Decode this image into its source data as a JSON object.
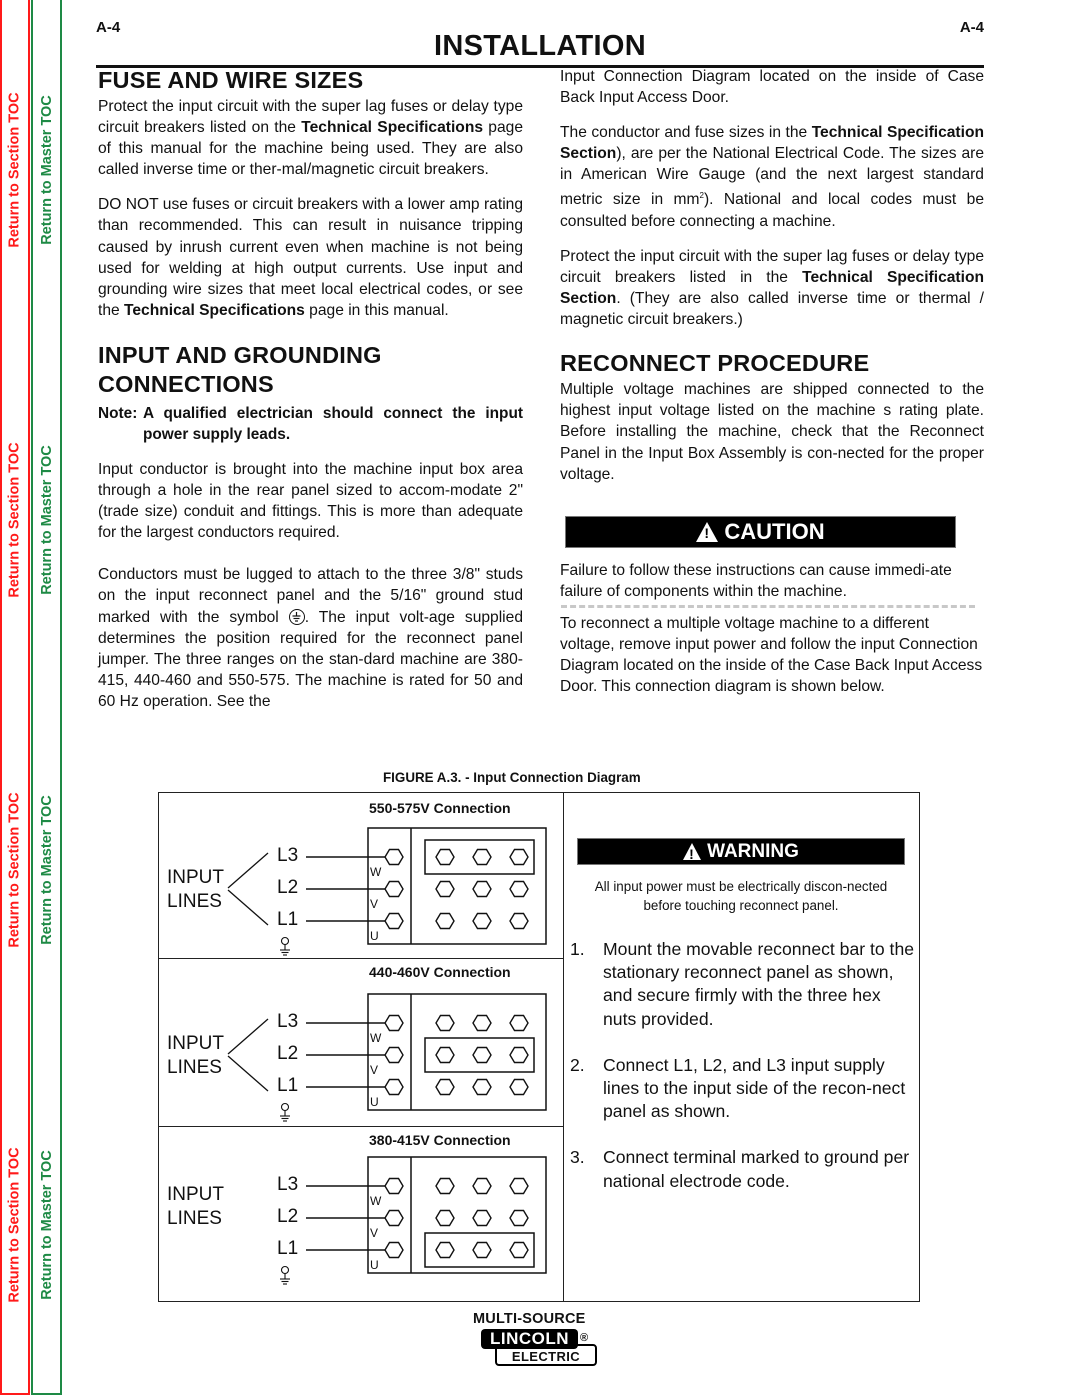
{
  "nav": {
    "section_toc_label": "Return to Section TOC",
    "master_toc_label": "Return to Master TOC",
    "section_color": "#ff1a1a",
    "master_color": "#1e8a45"
  },
  "header": {
    "page_left": "A-4",
    "page_right": "A-4",
    "title": "INSTALLATION"
  },
  "left_column": {
    "fuse_heading": "FUSE AND WIRE SIZES",
    "fuse_p1": {
      "a": "Protect the input circuit with the super lag fuses or delay type circuit breakers listed on the ",
      "b_bold": "Technical Specifications",
      "c": " page of this manual for the machine being used.  They are also called inverse time or ther-mal/magnetic circuit breakers."
    },
    "fuse_p2": {
      "a": "DO NOT use fuses or circuit breakers with a lower amp rating than recommended.  This can result in nuisance tripping caused by inrush current even when machine is not being used for welding at high output currents.  Use input and grounding wire sizes that meet local electrical codes, or see the ",
      "b_bold": "Technical Specifications",
      "c": " page in this manual."
    },
    "input_heading_line1": "INPUT AND GROUNDING",
    "input_heading_line2": "CONNECTIONS",
    "note_label": "Note:",
    "note_text": "A qualified electrician should connect the input power supply leads.",
    "input_p1": "Input conductor is brought into the machine input box area through a hole in the rear panel sized to accom-modate 2\" (trade size) conduit and fittings. This is more than adequate for the largest conductors required.",
    "input_p2": {
      "a": "Conductors must be lugged to attach to the three 3/8\" studs on the input reconnect panel and the 5/16\" ground stud marked with the symbol ",
      "b": ". The input volt-age supplied determines the position required for the reconnect panel jumper. The three ranges on the stan-dard machine are 380-415, 440-460 and 550-575. The machine is rated for 50 and 60 Hz operation. See the"
    }
  },
  "right_column": {
    "cont_p": "Input Connection Diagram located on the inside of Case Back Input Access Door.",
    "cond_p": {
      "a": "The conductor and fuse sizes in the ",
      "b_bold": "Technical Specification Section",
      "c": "), are per the National Electrical Code. The sizes are in American Wire Gauge (and the next largest standard metric size in mm",
      "sup": "2",
      "d": "). National and local codes must be consulted before connecting a machine."
    },
    "protect_p": {
      "a": "Protect the input circuit with the super lag fuses or delay type circuit breakers listed in the ",
      "b_bold": "Technical Specification Section",
      "c": ". (They are also called inverse time or thermal / magnetic circuit breakers.)"
    },
    "reconnect_heading": "RECONNECT PROCEDURE",
    "reconnect_p": "Multiple voltage machines are shipped connected to the highest input voltage listed on the machine s rating plate.  Before installing the machine, check that the Reconnect Panel in the Input Box Assembly is con-nected for the proper voltage.",
    "caution_label": "CAUTION",
    "caution_text": "Failure to follow these instructions can cause immedi-ate failure of components within the machine.",
    "reconnect_p2": "To reconnect a multiple voltage machine to a different voltage, remove input power and follow the input Connection Diagram located on the inside of the Case Back Input Access Door.  This connection diagram is shown below."
  },
  "figure": {
    "caption": "FIGURE A.3. - Input Connection Diagram",
    "input_label_1": "INPUT",
    "input_label_2": "LINES",
    "line_labels": [
      "L3",
      "L2",
      "L1"
    ],
    "terminal_labels": [
      "W",
      "V",
      "U"
    ],
    "connections": [
      {
        "title": "550-575V Connection",
        "jumper_row": 0
      },
      {
        "title": "440-460V Connection",
        "jumper_row": 1
      },
      {
        "title": "380-415V Connection",
        "jumper_row": 2
      }
    ],
    "warning_label": "WARNING",
    "warning_text": "All input power must be electrically discon-nected before touching reconnect panel.",
    "steps": [
      {
        "num": "1.",
        "text": "Mount the movable reconnect bar to the stationary reconnect panel as shown, and secure firmly with the three hex nuts provided."
      },
      {
        "num": "2.",
        "text": "Connect L1, L2, and L3 input supply lines to the input side of the recon-nect panel as shown."
      },
      {
        "num": "3.",
        "text": "Connect terminal marked to ground per national electrode code."
      }
    ]
  },
  "footer": {
    "product": "MULTI-SOURCE",
    "brand_top": "LINCOLN",
    "brand_reg": "®",
    "brand_bottom": "ELECTRIC"
  }
}
